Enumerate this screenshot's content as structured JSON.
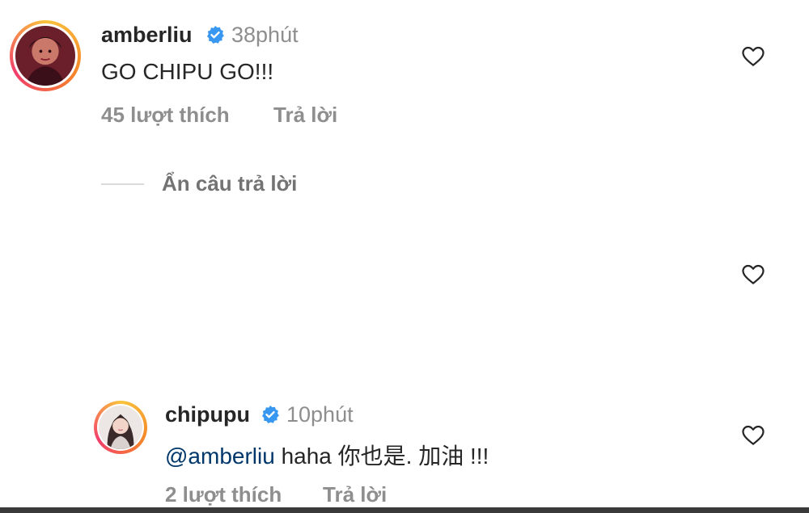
{
  "comments": [
    {
      "username": "amberliu",
      "time": "38phút",
      "text": "GO CHIPU GO!!!",
      "likes": "45 lượt thích",
      "reply": "Trả lời"
    }
  ],
  "hide_replies": "Ẩn câu trả lời",
  "replies": [
    {
      "username": "chipupu",
      "time": "10phút",
      "mention": "@amberliu",
      "text": " haha 你也是. 加油 !!!",
      "likes": "2 lượt thích",
      "reply": "Trả lời"
    }
  ],
  "icons": {
    "verified": "verified-badge-icon",
    "like": "heart-icon"
  },
  "colors": {
    "verified": "#3897f0",
    "mention": "#00376b",
    "muted": "#8e8e8e"
  }
}
